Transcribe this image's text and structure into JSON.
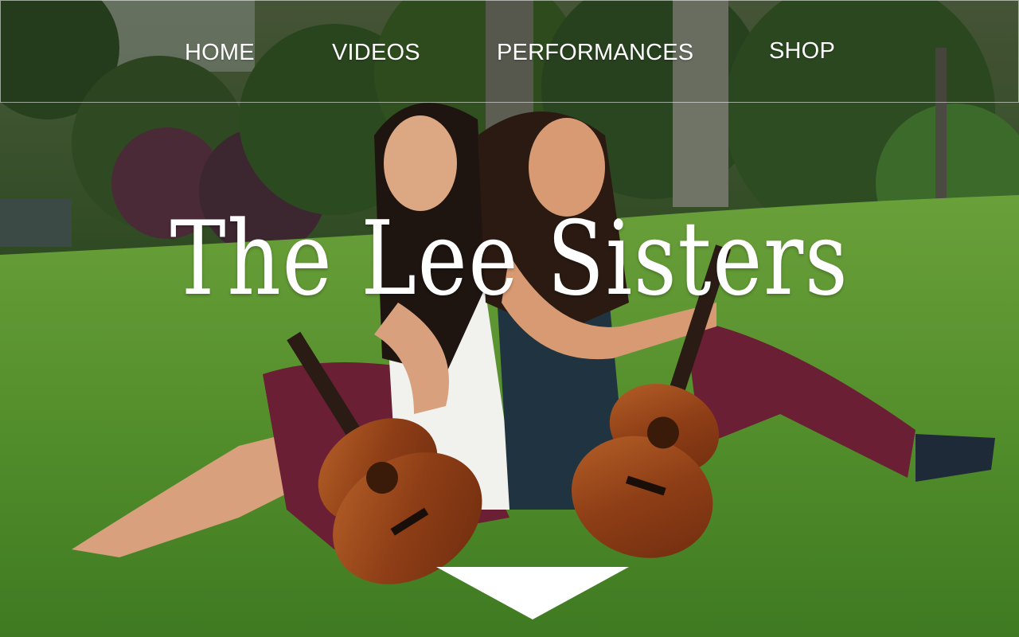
{
  "nav": {
    "items": [
      {
        "label": "HOME"
      },
      {
        "label": "VIDEOS"
      },
      {
        "label": "PERFORMANCES"
      },
      {
        "label": "SHOP"
      }
    ]
  },
  "hero": {
    "title": "The Lee Sisters",
    "scroll_icon": "down-triangle-icon"
  },
  "colors": {
    "nav_text": "#ffffff",
    "title_text": "#ffffff",
    "grass": "#4f8a2a",
    "foliage": "#2f4f25",
    "pants": "#6b1f35",
    "ukulele": "#9a4b1f"
  }
}
